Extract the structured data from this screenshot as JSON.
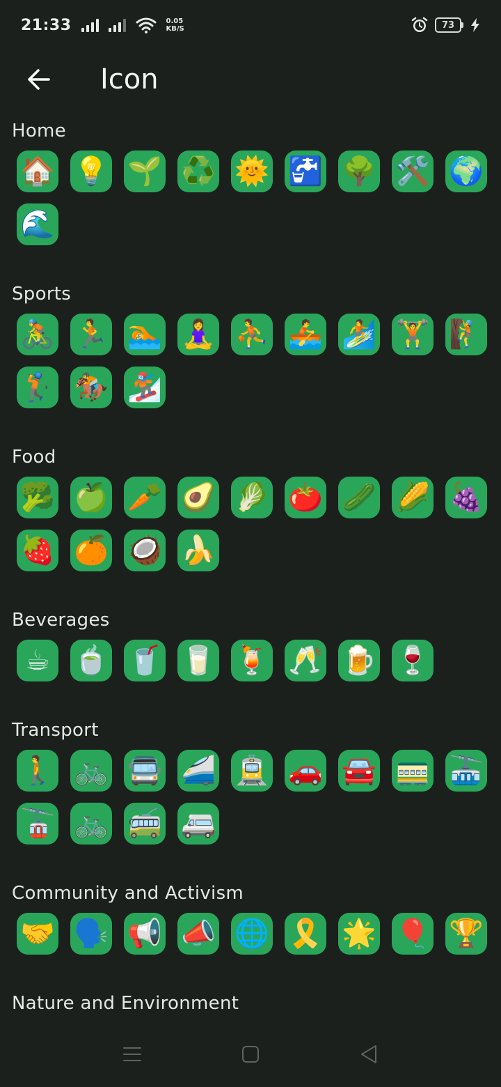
{
  "status_bar": {
    "time": "21:33",
    "net_speed_value": "0.05",
    "net_speed_unit": "KB/S",
    "battery_level": "73"
  },
  "header": {
    "title": "Icon"
  },
  "sections": [
    {
      "title": "Home",
      "icons": [
        "🏠",
        "💡",
        "🌱",
        "♻️",
        "🌞",
        "🚰",
        "🌳",
        "🛠️",
        "🌍",
        "🌊"
      ]
    },
    {
      "title": "Sports",
      "icons": [
        "🚴",
        "🏃",
        "🏊",
        "🧘‍♀️",
        "⛹️",
        "🚣",
        "🏄",
        "🏋️",
        "🧗",
        "🏌️",
        "🏇",
        "🏂"
      ]
    },
    {
      "title": "Food",
      "icons": [
        "🥦",
        "🍏",
        "🥕",
        "🥑",
        "🥬",
        "🍅",
        "🥒",
        "🌽",
        "🍇",
        "🍓",
        "🍊",
        "🥥",
        "🍌"
      ]
    },
    {
      "title": "Beverages",
      "icons": [
        "☕",
        "🍵",
        "🥤",
        "🥛",
        "🍹",
        "🥂",
        "🍺",
        "🍷"
      ]
    },
    {
      "title": "Transport",
      "icons": [
        "🚶",
        "🚲",
        "🚍",
        "🚄",
        "🚊",
        "🚗",
        "🚘",
        "🚃",
        "🚠",
        "🚡",
        "🚲",
        "🚎",
        "🚐"
      ]
    },
    {
      "title": "Community and Activism",
      "icons": [
        "🤝",
        "🗣️",
        "📢",
        "📣",
        "🌐",
        "🎗️",
        "🌟",
        "🎈",
        "🏆"
      ]
    },
    {
      "title": "Nature and Environment",
      "icons": [
        "🌳",
        "🌿",
        "🌻",
        "🍃",
        "🌲",
        "🌊",
        "🏞️",
        "🏔️",
        "🌍",
        "🌱"
      ]
    }
  ],
  "colors": {
    "background": "#1b201d",
    "tile": "#2aa65b",
    "text": "#e4e8e4"
  }
}
